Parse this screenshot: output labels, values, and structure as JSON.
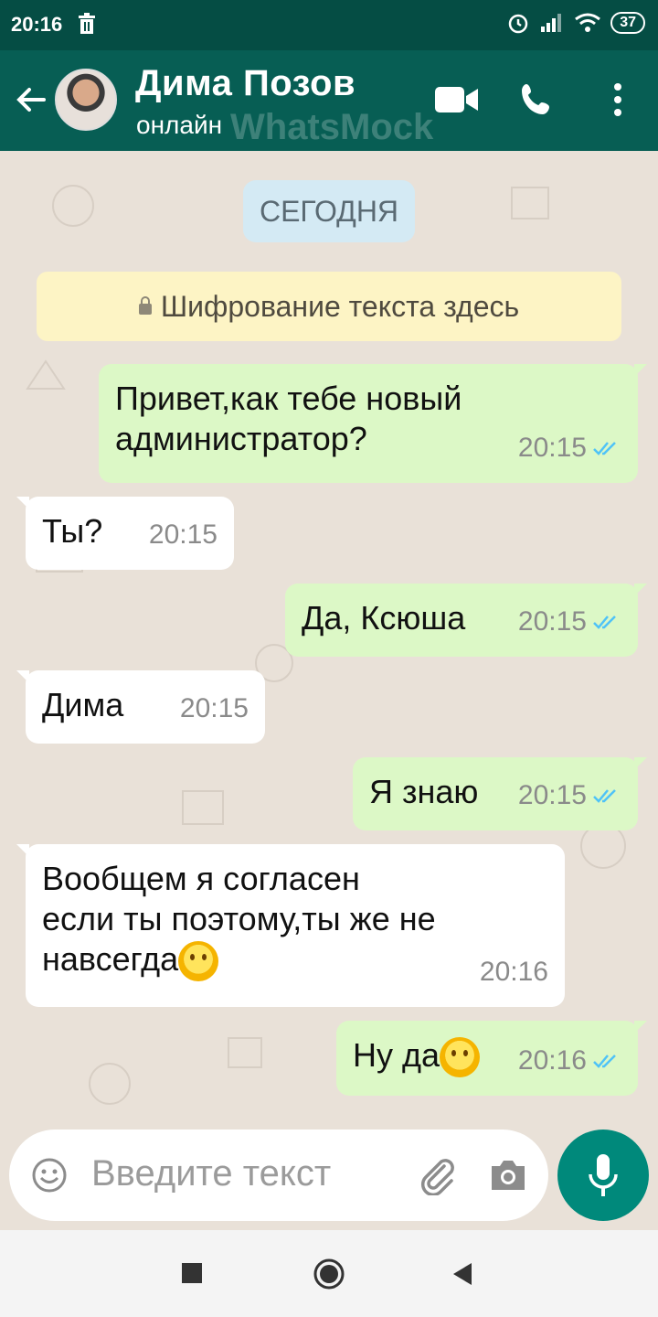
{
  "status_bar": {
    "time": "20:16",
    "battery": "37"
  },
  "header": {
    "contact_name": "Дима Позов",
    "contact_status": "онлайн",
    "watermark": "WhatsMock"
  },
  "chat": {
    "date_chip": "СЕГОДНЯ",
    "encryption_notice": "Шифрование текста здесь",
    "messages": [
      {
        "direction": "out",
        "text_lines": [
          "Привет,как тебе новый",
          "администратор?"
        ],
        "time": "20:15",
        "read": true
      },
      {
        "direction": "in",
        "text_lines": [
          "Ты?"
        ],
        "time": "20:15"
      },
      {
        "direction": "out",
        "text_lines": [
          "Да, Ксюша"
        ],
        "time": "20:15",
        "read": true
      },
      {
        "direction": "in",
        "text_lines": [
          "Дима"
        ],
        "time": "20:15"
      },
      {
        "direction": "out",
        "text_lines": [
          "Я знаю"
        ],
        "time": "20:15",
        "read": true
      },
      {
        "direction": "in",
        "text_lines": [
          "Вообщем я согласен",
          "если ты поэтому,ты же не",
          "навсегда"
        ],
        "emoji": "slightly-smiling-face",
        "time": "20:16"
      },
      {
        "direction": "out",
        "text_lines": [
          "Ну да"
        ],
        "emoji": "grinning-face-with-sweat",
        "time": "20:16",
        "read": true
      }
    ]
  },
  "composer": {
    "placeholder": "Введите текст"
  },
  "colors": {
    "header": "#075e54",
    "status_bar": "#054d44",
    "outgoing_bubble": "#dcf8c6",
    "incoming_bubble": "#ffffff",
    "mic_button": "#00897b",
    "read_ticks": "#4fc3f7"
  },
  "icons": [
    "trash-icon",
    "alarm-icon",
    "signal-icon",
    "wifi-icon",
    "back-arrow-icon",
    "video-call-icon",
    "phone-icon",
    "more-vert-icon",
    "emoji-icon",
    "attach-icon",
    "camera-icon",
    "mic-icon",
    "nav-recents-icon",
    "nav-home-icon",
    "nav-back-icon"
  ]
}
